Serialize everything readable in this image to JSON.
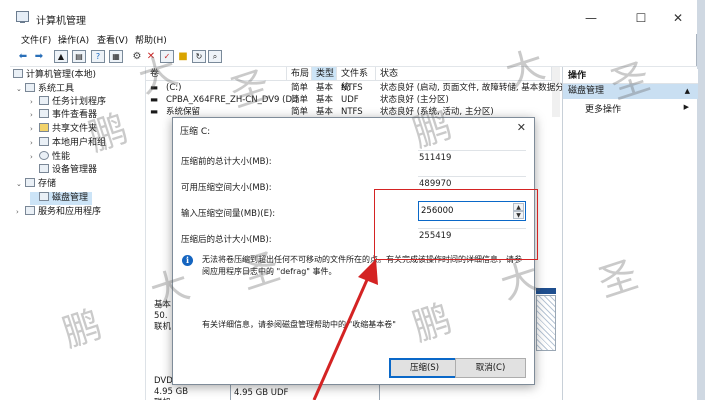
{
  "window": {
    "title": "计算机管理",
    "controls": [
      "—",
      "☐",
      "✕"
    ]
  },
  "menu": [
    "文件(F)",
    "操作(A)",
    "查看(V)",
    "帮助(H)"
  ],
  "toolbar_icons": [
    "back-icon",
    "forward-icon",
    "up-icon",
    "properties-icon",
    "help-icon",
    "view-icon",
    "connect-icon",
    "delete-icon",
    "check-icon",
    "folder-icon",
    "refresh-icon",
    "search-icon"
  ],
  "tree": {
    "root": "计算机管理(本地)",
    "items": [
      {
        "label": "系统工具",
        "level": 1,
        "expander": "⌄"
      },
      {
        "label": "任务计划程序",
        "level": 2,
        "expander": "›"
      },
      {
        "label": "事件查看器",
        "level": 2,
        "expander": "›"
      },
      {
        "label": "共享文件夹",
        "level": 2,
        "expander": "›"
      },
      {
        "label": "本地用户和组",
        "level": 2,
        "expander": "›"
      },
      {
        "label": "性能",
        "level": 2,
        "expander": "›"
      },
      {
        "label": "设备管理器",
        "level": 2,
        "expander": ""
      },
      {
        "label": "存储",
        "level": 1,
        "expander": "⌄"
      },
      {
        "label": "磁盘管理",
        "level": 2,
        "expander": ""
      },
      {
        "label": "服务和应用程序",
        "level": 1,
        "expander": "›"
      }
    ]
  },
  "volume_list": {
    "columns": [
      "卷",
      "布局",
      "类型",
      "文件系统",
      "状态"
    ],
    "rows": [
      {
        "name": "(C:)",
        "layout": "简单",
        "type": "基本",
        "fs": "NTFS",
        "status": "状态良好 (启动, 页面文件, 故障转储, 基本数据分区)"
      },
      {
        "name": "CPBA_X64FRE_ZH-CN_DV9 (D:)",
        "layout": "简单",
        "type": "基本",
        "fs": "UDF",
        "status": "状态良好 (主分区)"
      },
      {
        "name": "系统保留",
        "layout": "简单",
        "type": "基本",
        "fs": "NTFS",
        "status": "状态良好 (系统, 活动, 主分区)"
      }
    ]
  },
  "disks": {
    "disk0": [
      "基本",
      "50.",
      "联机"
    ],
    "dvd": [
      "DVD",
      "4.95 GB",
      "联机"
    ],
    "dvd_part": "4.95 GB UDF"
  },
  "actions": {
    "header": "操作",
    "section": "磁盘管理",
    "item": "更多操作"
  },
  "dialog": {
    "title": "压缩 C:",
    "total_before_label": "压缩前的总计大小(MB):",
    "total_before_value": "511419",
    "available_label": "可用压缩空间大小(MB):",
    "available_value": "489970",
    "input_label": "输入压缩空间量(MB)(E):",
    "input_value": "256000",
    "total_after_label": "压缩后的总计大小(MB):",
    "total_after_value": "255419",
    "warning": "无法将卷压缩到超出任何不可移动的文件所在的点。有关完成该操作时间的详细信息，请参阅应用程序日志中的 \"defrag\" 事件。",
    "more_info": "有关详细信息，请参阅磁盘管理帮助中的 \"收缩基本卷\"",
    "shrink_button": "压缩(S)",
    "cancel_button": "取消(C)"
  },
  "watermark": [
    "鹏",
    "大",
    "圣"
  ],
  "colors": {
    "accent": "#0a68c8",
    "selection": "#cce4f7",
    "highlight_box": "#d42323",
    "disk_bar": "#1f4f8f"
  }
}
